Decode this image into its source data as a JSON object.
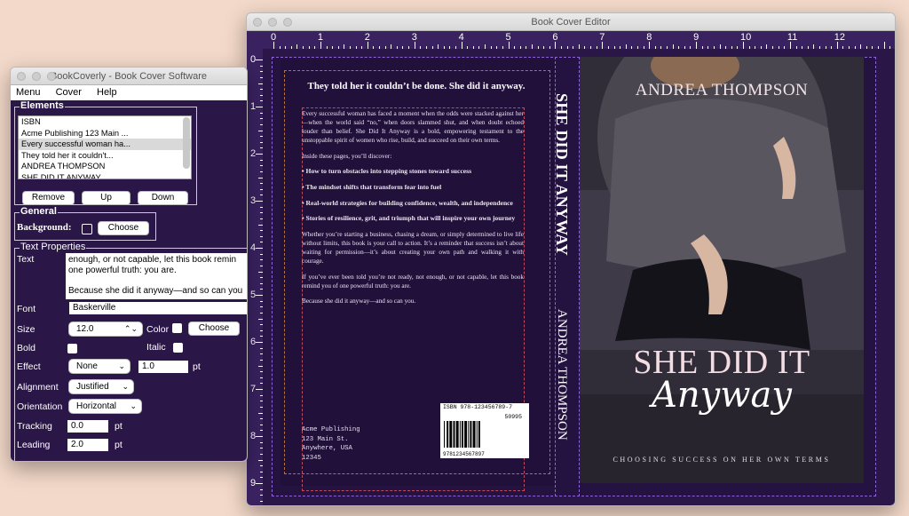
{
  "editor": {
    "title": "Book Cover Editor"
  },
  "ruler": {
    "top": [
      "0",
      "1",
      "2",
      "3",
      "4",
      "5",
      "6",
      "7",
      "8",
      "9",
      "10",
      "11",
      "12"
    ],
    "left": [
      "0",
      "1",
      "2",
      "3",
      "4",
      "5",
      "6",
      "7",
      "8",
      "9"
    ]
  },
  "back_cover": {
    "headline": "They told her it couldn’t be done. She did it anyway.",
    "paragraphs": [
      {
        "text": "Every successful woman has faced a moment when the odds were stacked against her—when the world said “no,” when doors slammed shut, and when doubt echoed louder than belief. She Did It Anyway is a bold, empowering testament to the unstoppable spirit of women who rise, build, and succeed on their own terms.",
        "bold": false
      },
      {
        "text": "Inside these pages, you’ll discover:",
        "bold": false
      },
      {
        "text": "• How to turn obstacles into stepping stones toward success",
        "bold": true
      },
      {
        "text": "• The mindset shifts that transform fear into fuel",
        "bold": true
      },
      {
        "text": "• Real-world strategies for building confidence, wealth, and independence",
        "bold": true
      },
      {
        "text": "• Stories of resilience, grit, and triumph that will inspire your own journey",
        "bold": true
      },
      {
        "text": "Whether you’re starting a business, chasing a dream, or simply determined to live life without limits, this book is your call to action. It’s a reminder that success isn’t about waiting for permission—it’s about creating your own path and walking it with courage.",
        "bold": false
      },
      {
        "text": "If you’ve ever been told you’re not ready, not enough, or not capable, let this book remind you of one powerful truth: you are.",
        "bold": false
      },
      {
        "text": "Because she did it anyway—and so can you.",
        "bold": false
      }
    ],
    "publisher_lines": [
      "Acme Publishing",
      "123 Main St.",
      "Anywhere, USA",
      "12345"
    ],
    "isbn_label": "ISBN 978-123456789-7",
    "price_code": "50995",
    "barcode_number": "9781234567897"
  },
  "spine": {
    "title": "SHE DID IT ANYWAY",
    "author": "ANDREA THOMPSON"
  },
  "front_cover": {
    "author": "ANDREA THOMPSON",
    "title": "SHE DID IT",
    "script": "Anyway",
    "subtitle": "CHOOSING SUCCESS ON HER OWN TERMS"
  },
  "app": {
    "title": "BookCoverly - Book Cover Software",
    "menu": [
      "Menu",
      "Cover",
      "Help"
    ],
    "elements": {
      "legend": "Elements",
      "items": [
        "ISBN",
        "Acme Publishing 123 Main ...",
        "Every successful woman ha...",
        "They told her it couldn't...",
        "ANDREA THOMPSON",
        "SHE DID IT ANYWAY"
      ],
      "selected_index": 2,
      "remove": "Remove",
      "up": "Up",
      "down": "Down"
    },
    "general": {
      "legend": "General",
      "background_label": "Background:",
      "choose": "Choose"
    },
    "text_props": {
      "legend": "Text Properties",
      "text_label": "Text",
      "text_lines": [
        "enough, or not capable, let this book remin",
        "one powerful truth: you are.",
        "",
        "Because she did it anyway—and so can you"
      ],
      "font_label": "Font",
      "font_value": "Baskerville",
      "size_label": "Size",
      "size_value": "12.0",
      "color_label": "Color",
      "color_choose": "Choose",
      "bold_label": "Bold",
      "italic_label": "Italic",
      "effect_label": "Effect",
      "effect_value": "None",
      "effect_amount": "1.0",
      "effect_unit": "pt",
      "alignment_label": "Alignment",
      "alignment_value": "Justified",
      "orientation_label": "Orientation",
      "orientation_value": "Horizontal",
      "tracking_label": "Tracking",
      "tracking_value": "0.0",
      "tracking_unit": "pt",
      "leading_label": "Leading",
      "leading_value": "2.0",
      "leading_unit": "pt"
    }
  }
}
